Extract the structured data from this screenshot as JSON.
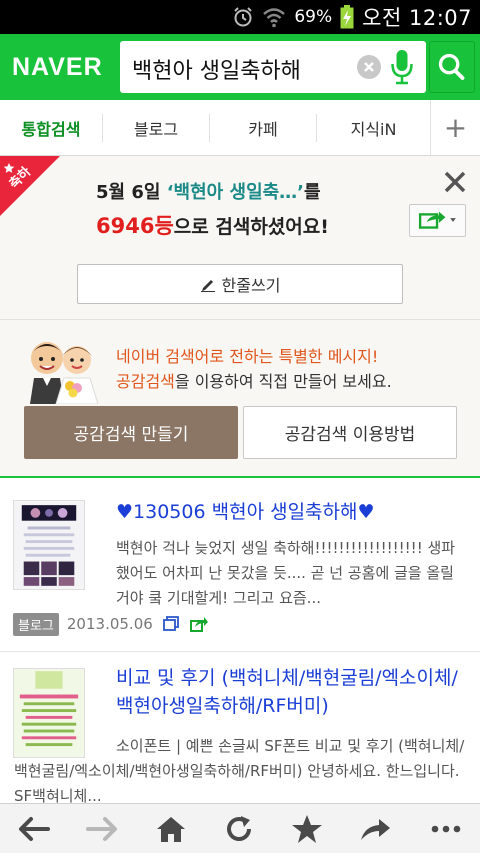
{
  "status_bar": {
    "battery_percent": "69%",
    "time": "오전 12:07"
  },
  "header": {
    "logo": "NAVER",
    "search_query": "백현아 생일축하해"
  },
  "tabs": [
    {
      "label": "통합검색",
      "active": true
    },
    {
      "label": "블로그",
      "active": false
    },
    {
      "label": "카페",
      "active": false
    },
    {
      "label": "지식iN",
      "active": false
    }
  ],
  "congrats": {
    "ribbon_text": "축하",
    "line1_date": "5월 6일",
    "line1_keyword": "‘백현아 생일축…’",
    "line1_suffix": "를",
    "rank": "6946등",
    "line2_suffix": "으로 검색하셨어요!",
    "write_button": "한줄쓰기"
  },
  "special": {
    "line1": "네이버 검색어로 전하는 특별한 메시지!",
    "line2_highlight": "공감검색",
    "line2_rest": "을 이용하여 직접 만들어 보세요.",
    "make_button": "공감검색 만들기",
    "howto_button": "공감검색 이용방법"
  },
  "results": [
    {
      "title": "♥130506 백현아 생일축하해♥",
      "snippet": "백현아 걱나 늦었지 생일 축하해!!!!!!!!!!!!!!!!!! 생파했어도 어차피 난 못갔을 듯.... 곧 넌 공홈에 글을 올릴거야 쿸 기대할게! 그리고 요즘...",
      "source_badge": "블로그",
      "date": "2013.05.06"
    },
    {
      "title": "비교 및 후기 (백혀니체/백현굴림/엑소이체/백현아생일축하해/RF버미)",
      "snippet": "소이폰트 | 예쁜 손글씨 SF폰트 비교 및 후기 (백혀니체/백현굴림/엑소이체/백현아생일축하해/RF버미) 안녕하세요. 한느입니다. SF백혀니체..."
    }
  ],
  "colors": {
    "naver_green": "#18c23a",
    "rank_red": "#e21f1f",
    "link_blue": "#1a3ed6",
    "accent_orange": "#e0561d"
  }
}
